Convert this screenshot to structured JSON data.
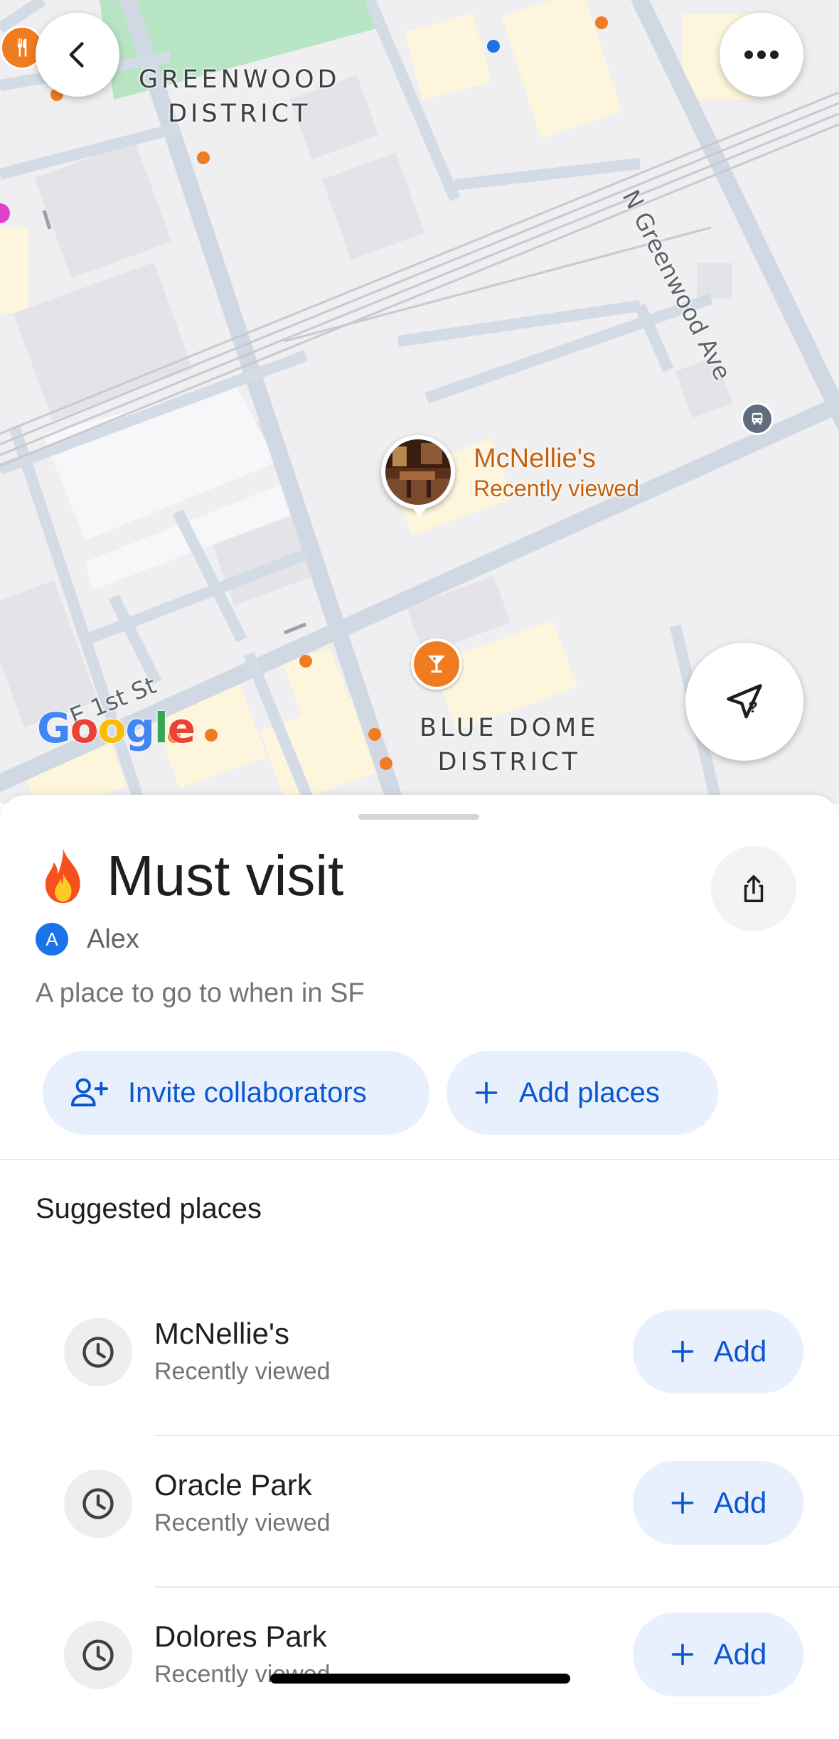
{
  "map": {
    "districts": [
      "GREENWOOD\nDISTRICT",
      "BLUE DOME\nDISTRICT"
    ],
    "greenwood_line1": "GREENWOOD",
    "greenwood_line2": "DISTRICT",
    "bluedome_line1": "BLUE DOME",
    "bluedome_line2": "DISTRICT",
    "street_greenwood": "N Greenwood Ave",
    "street_first": "E 1st St",
    "poi": {
      "name": "McNellie's",
      "status": "Recently viewed"
    },
    "icons": {
      "back": "chevron-left-icon",
      "more": "more-horiz-icon",
      "location": "location-arrow-question-icon",
      "restaurant": "fork-knife-icon",
      "bar": "cocktail-icon",
      "transit": "bus-icon"
    },
    "colors": {
      "poi_orange": "#f07c22",
      "road": "#cfd8e3",
      "park": "#b7e4c2"
    }
  },
  "list": {
    "title_emoji": "fire",
    "title": "Must visit",
    "owner_initial": "A",
    "owner_name": "Alex",
    "description": "A place to go to when in SF",
    "invite_label": "Invite collaborators",
    "add_places_label": "Add places"
  },
  "suggested": {
    "heading": "Suggested places",
    "add_label": "Add",
    "items": [
      {
        "name": "McNellie's",
        "status": "Recently viewed"
      },
      {
        "name": "Oracle Park",
        "status": "Recently viewed"
      },
      {
        "name": "Dolores Park",
        "status": "Recently viewed"
      }
    ]
  },
  "google_logo": "Google"
}
